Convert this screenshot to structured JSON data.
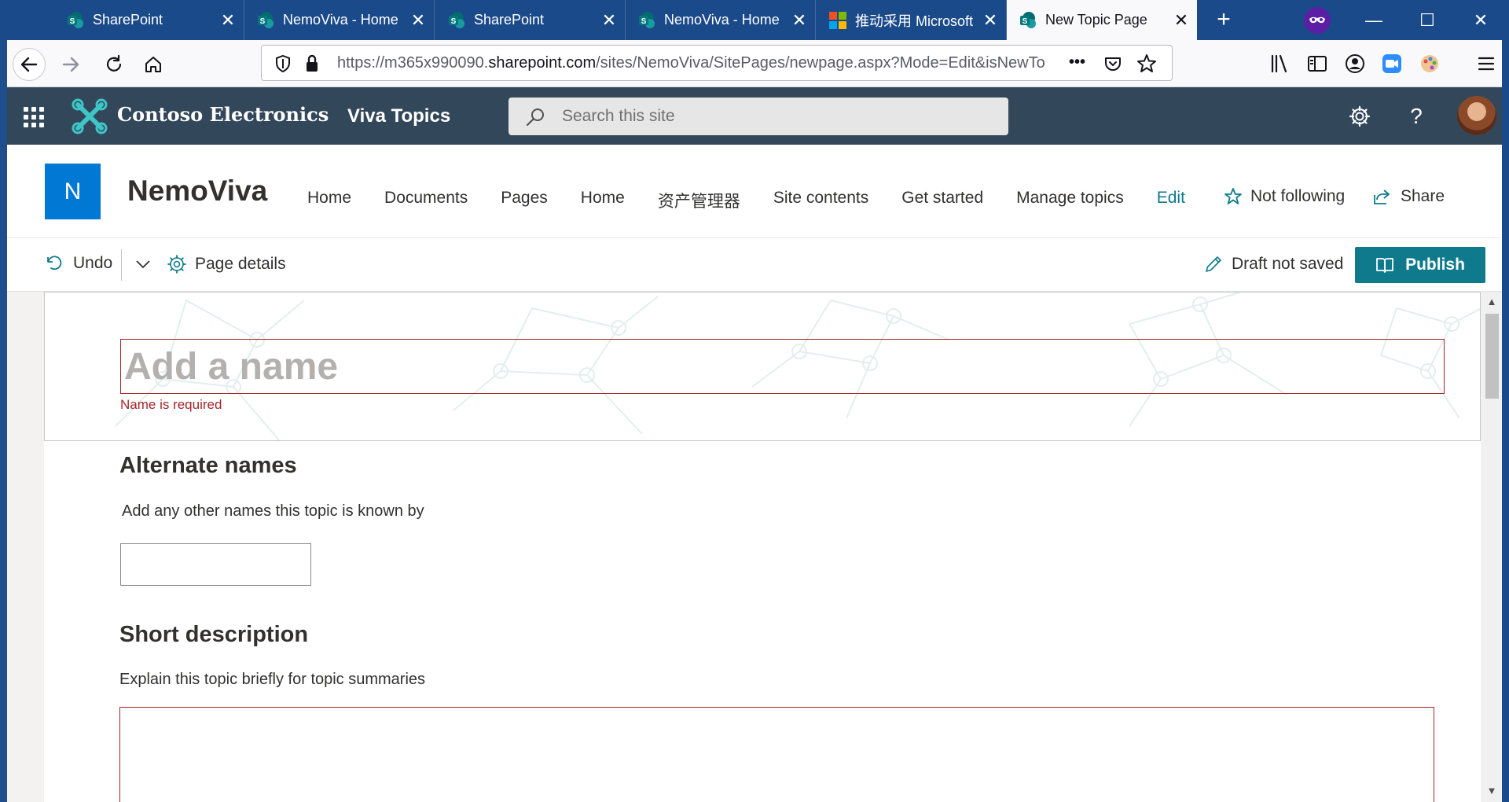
{
  "browser": {
    "tabs": [
      {
        "title": "SharePoint",
        "icon": "sharepoint-icon"
      },
      {
        "title": "NemoViva - Home",
        "icon": "sharepoint-icon"
      },
      {
        "title": "SharePoint",
        "icon": "sharepoint-icon"
      },
      {
        "title": "NemoViva - Home",
        "icon": "sharepoint-icon"
      },
      {
        "title": "推动采用 Microsoft",
        "icon": "microsoft-icon"
      },
      {
        "title": "New Topic Page",
        "icon": "sharepoint-icon",
        "active": true
      }
    ],
    "url": {
      "prefix": "https://m365x990090.",
      "domain": "sharepoint.com",
      "suffix": "/sites/NemoViva/SitePages/newpage.aspx?Mode=Edit&isNewTo"
    },
    "more_label": "•••"
  },
  "suite": {
    "brand": "Contoso Electronics",
    "hub": "Viva Topics",
    "search_placeholder": "Search this site"
  },
  "site": {
    "logo_letter": "N",
    "title": "NemoViva",
    "nav": [
      "Home",
      "Documents",
      "Pages",
      "Home",
      "资产管理器",
      "Site contents",
      "Get started",
      "Manage topics",
      "Edit"
    ],
    "follow_label": "Not following",
    "share_label": "Share"
  },
  "command_bar": {
    "undo_label": "Undo",
    "page_details_label": "Page details",
    "draft_status": "Draft not saved",
    "publish_label": "Publish"
  },
  "topic": {
    "name_placeholder": "Add a name",
    "name_error": "Name is required",
    "alt_names_heading": "Alternate names",
    "alt_names_desc": "Add any other names this topic is known by",
    "short_desc_heading": "Short description",
    "short_desc_desc": "Explain this topic briefly for topic summaries"
  },
  "colors": {
    "suite_bar": "#33475b",
    "accent": "#0f7a8c",
    "error": "#a4262c",
    "site_logo": "#0078d4"
  }
}
